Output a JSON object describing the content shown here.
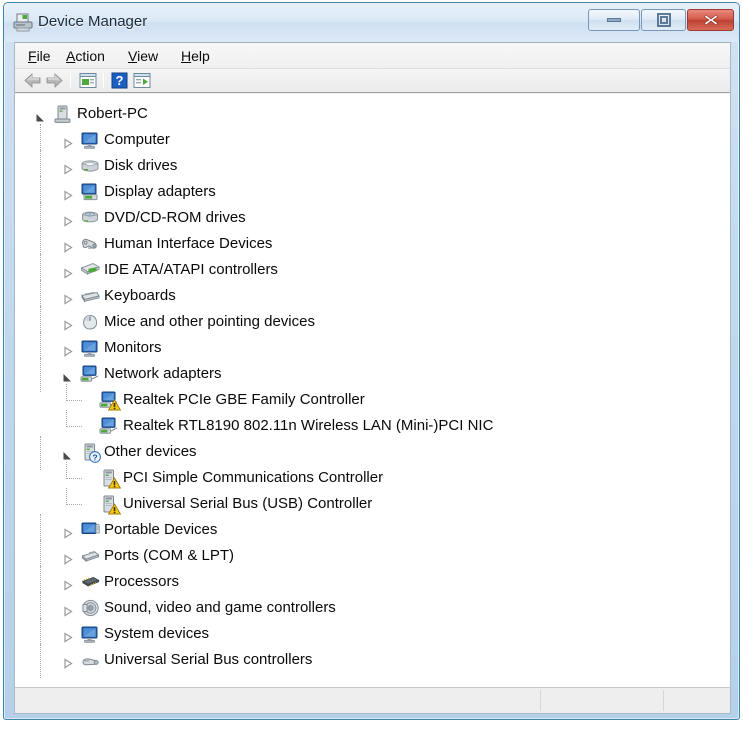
{
  "window": {
    "title": "Device Manager",
    "icon": "device-manager-icon",
    "controls": {
      "minimize": "Minimize",
      "maximize": "Restore",
      "close": "Close"
    },
    "frame_color": "#b5d0ea",
    "close_color": "#bd4233"
  },
  "menubar": {
    "items": [
      {
        "label": "File",
        "accel": "F"
      },
      {
        "label": "Action",
        "accel": "A"
      },
      {
        "label": "View",
        "accel": "V"
      },
      {
        "label": "Help",
        "accel": "H"
      }
    ]
  },
  "toolbar": {
    "items": [
      {
        "name": "back-arrow-icon",
        "tooltip": "Back"
      },
      {
        "name": "forward-arrow-icon",
        "tooltip": "Forward"
      },
      {
        "name": "properties-icon",
        "tooltip": "Properties"
      },
      {
        "name": "help-icon",
        "tooltip": "Help"
      },
      {
        "name": "scan-hardware-icon",
        "tooltip": "Scan for hardware changes"
      }
    ]
  },
  "tree": {
    "root": {
      "label": "Robert-PC",
      "icon": "computer-tower-icon",
      "expanded": true
    },
    "nodes": [
      {
        "label": "Computer",
        "icon": "monitor-icon",
        "expanded": false,
        "depth": 1
      },
      {
        "label": "Disk drives",
        "icon": "disk-drive-icon",
        "expanded": false,
        "depth": 1
      },
      {
        "label": "Display adapters",
        "icon": "display-adapter-icon",
        "expanded": false,
        "depth": 1
      },
      {
        "label": "DVD/CD-ROM drives",
        "icon": "dvd-drive-icon",
        "expanded": false,
        "depth": 1
      },
      {
        "label": "Human Interface Devices",
        "icon": "gamepad-icon",
        "expanded": false,
        "depth": 1
      },
      {
        "label": "IDE ATA/ATAPI controllers",
        "icon": "ide-controller-icon",
        "expanded": false,
        "depth": 1
      },
      {
        "label": "Keyboards",
        "icon": "keyboard-icon",
        "expanded": false,
        "depth": 1
      },
      {
        "label": "Mice and other pointing devices",
        "icon": "mouse-icon",
        "expanded": false,
        "depth": 1
      },
      {
        "label": "Monitors",
        "icon": "monitor-icon",
        "expanded": false,
        "depth": 1
      },
      {
        "label": "Network adapters",
        "icon": "network-adapter-icon",
        "expanded": true,
        "depth": 1
      },
      {
        "label": "Realtek PCIe GBE Family Controller",
        "icon": "network-adapter-icon",
        "depth": 2,
        "badge": "warning"
      },
      {
        "label": "Realtek RTL8190 802.11n Wireless LAN (Mini-)PCI NIC",
        "icon": "network-adapter-icon",
        "depth": 2,
        "badge": "none"
      },
      {
        "label": "Other devices",
        "icon": "generic-device-icon",
        "expanded": true,
        "depth": 1,
        "badge": "unknown"
      },
      {
        "label": "PCI Simple Communications Controller",
        "icon": "generic-device-icon",
        "depth": 2,
        "badge": "warning"
      },
      {
        "label": "Universal Serial Bus (USB) Controller",
        "icon": "generic-device-icon",
        "depth": 2,
        "badge": "warning"
      },
      {
        "label": "Portable Devices",
        "icon": "portable-device-icon",
        "expanded": false,
        "depth": 1
      },
      {
        "label": "Ports (COM & LPT)",
        "icon": "port-icon",
        "expanded": false,
        "depth": 1
      },
      {
        "label": "Processors",
        "icon": "processor-icon",
        "expanded": false,
        "depth": 1
      },
      {
        "label": "Sound, video and game controllers",
        "icon": "speaker-icon",
        "expanded": false,
        "depth": 1
      },
      {
        "label": "System devices",
        "icon": "monitor-icon",
        "expanded": false,
        "depth": 1
      },
      {
        "label": "Universal Serial Bus controllers",
        "icon": "usb-icon",
        "expanded": false,
        "depth": 1
      }
    ]
  },
  "statusbar": {
    "pane1": "",
    "pane2": "",
    "pane3": ""
  }
}
